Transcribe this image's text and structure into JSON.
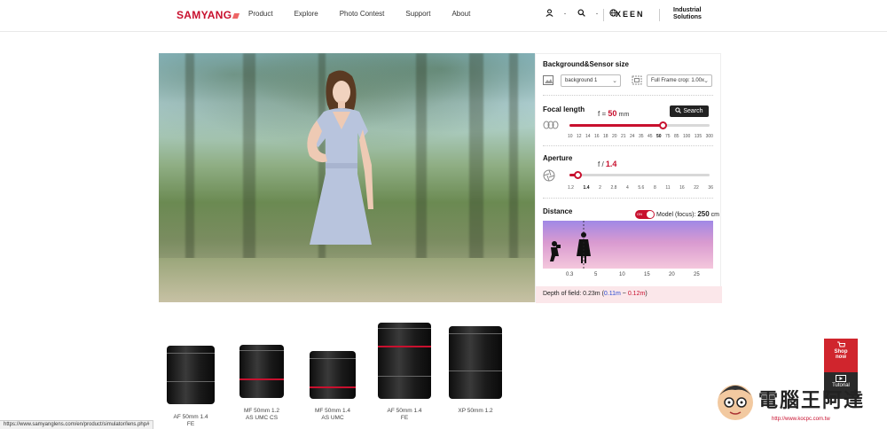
{
  "header": {
    "logo": "SAMYANG",
    "nav": [
      "Product",
      "Explore",
      "Photo Contest",
      "Support",
      "About"
    ],
    "xeen": "XEEN",
    "industrial_line1": "Industrial",
    "industrial_line2": "Solutions"
  },
  "panel": {
    "bg_title": "Background&Sensor size",
    "background_select": "background 1",
    "sensor_select": "Full Frame crop: 1.00x",
    "focal_title": "Focal length",
    "focal_prefix": "f =",
    "focal_value": "50",
    "focal_unit": "mm",
    "search_label": "Search",
    "focal_ticks": [
      "10",
      "12",
      "14",
      "16",
      "18",
      "20",
      "21",
      "24",
      "35",
      "45",
      "50",
      "75",
      "85",
      "100",
      "135",
      "300"
    ],
    "focal_level": 0.67,
    "aperture_title": "Aperture",
    "aperture_prefix": "f /",
    "aperture_value": "1.4",
    "aperture_ticks": [
      "1.2",
      "1.4",
      "2",
      "2.8",
      "4",
      "5.6",
      "8",
      "11",
      "16",
      "22",
      "36"
    ],
    "aperture_level": 0.06,
    "distance_title": "Distance",
    "toggle_label": "ON",
    "model_focus_label": "Model (focus):",
    "model_focus_value": "250",
    "model_focus_unit": "cm",
    "distance_ticks": [
      "0.3",
      "5",
      "10",
      "15",
      "20",
      "25"
    ],
    "dof_label": "Depth of field:",
    "dof_value": "0.23m",
    "dof_near": "0.11m",
    "dof_tilde": "~",
    "dof_far": "0.12m"
  },
  "lenses": [
    {
      "name_line1": "AF 50mm 1.4",
      "name_line2": "FE"
    },
    {
      "name_line1": "MF 50mm 1.2",
      "name_line2": "AS UMC CS"
    },
    {
      "name_line1": "MF 50mm 1.4",
      "name_line2": "AS UMC"
    },
    {
      "name_line1": "AF 50mm 1.4",
      "name_line2": "FE"
    },
    {
      "name_line1": "XP 50mm 1.2",
      "name_line2": ""
    }
  ],
  "side": {
    "shop_line1": "Shop",
    "shop_line2": "now",
    "tutorial": "Tutorial"
  },
  "status_url": "https://www.samyanglens.com/en/product/simulator/lens.php#",
  "watermark": {
    "text": "電腦王阿達",
    "url": "http://www.kocpc.com.tw"
  },
  "colors": {
    "accent": "#c8102e",
    "dof_blue": "#2b4bd1"
  }
}
